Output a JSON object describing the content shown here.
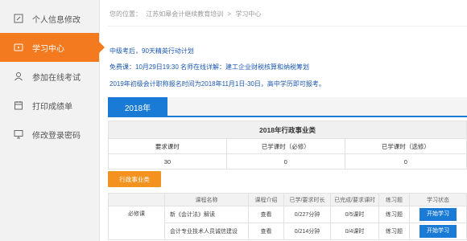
{
  "sidebar": {
    "items": [
      {
        "label": "个人信息修改",
        "icon": "edit-icon"
      },
      {
        "label": "学习中心",
        "icon": "play-icon",
        "active": true
      },
      {
        "label": "参加在线考试",
        "icon": "user-icon"
      },
      {
        "label": "打印成绩单",
        "icon": "calendar-icon"
      },
      {
        "label": "修改登录密码",
        "icon": "monitor-icon"
      }
    ]
  },
  "breadcrumb": {
    "prefix": "您的位置：",
    "items": [
      "江苏如皋会计继续教育培训",
      ">",
      "学习中心"
    ]
  },
  "notices": [
    "中级考后，90天精英行动计划",
    "免费课：10月29日19:30 名师在线详解：建工企业财税核算和纳税筹划",
    "2019年初级会计职称报名时间为2018年11月1日-30日，高中学历即可报考。"
  ],
  "year_tab": "2018年",
  "summary": {
    "caption": "2018年行政事业类",
    "headers": [
      "要求课时",
      "已学课时（必修）",
      "已学课时（选修）"
    ],
    "values": [
      "30",
      "0",
      "0"
    ]
  },
  "category_button": "行政事业类",
  "course_table": {
    "headers": [
      "",
      "课程名称",
      "课程介绍",
      "已学/要求时长",
      "已完成/要求课时",
      "练习题",
      "学习状态"
    ],
    "group_label": "必修课",
    "rows": [
      {
        "name": "新《会计法》解读",
        "intro": "查看",
        "time": "0/227分钟",
        "hours": "0/5课时",
        "exercise": "练习题",
        "status": "开始学习"
      },
      {
        "name": "会计专业技术人员诚信建设",
        "intro": "查看",
        "time": "0/214分钟",
        "hours": "0/4课时",
        "exercise": "练习题",
        "status": "开始学习"
      }
    ]
  },
  "colors": {
    "accent": "#f47a1f",
    "primary": "#1a7bd6",
    "notice": "#1a57b0"
  }
}
